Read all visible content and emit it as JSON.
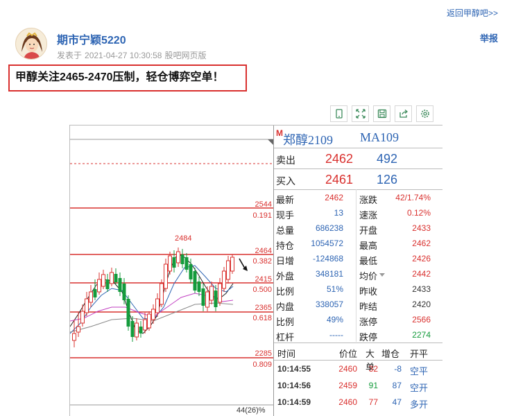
{
  "header": {
    "back_link": "返回甲醇吧>>",
    "author": "期市宁颖5220",
    "posted_label": "发表于",
    "posted_time": "2021-04-27 10:30:58",
    "source": "股吧网页版",
    "report": "举报"
  },
  "post": {
    "title": "甲醇关注2465-2470压制，轻仓博弈空单！"
  },
  "toolbar": {
    "icons": [
      "phone-icon",
      "expand-icon",
      "save-icon",
      "share-icon",
      "settings-icon"
    ]
  },
  "chart": {
    "levels": [
      {
        "price": "2544",
        "ratio": "0.191"
      },
      {
        "price": "2484",
        "ratio": ""
      },
      {
        "price": "2464",
        "ratio": "0.382"
      },
      {
        "price": "2415",
        "ratio": "0.500"
      },
      {
        "price": "2365",
        "ratio": "0.618"
      },
      {
        "price": "2285",
        "ratio": "0.809"
      }
    ],
    "bottom_label": "44(26)%"
  },
  "quote": {
    "marker": "M",
    "name": "郑醇2109",
    "ma": "MA109",
    "sell_label": "卖出",
    "sell_price": "2462",
    "sell_vol": "492",
    "buy_label": "买入",
    "buy_price": "2461",
    "buy_vol": "126",
    "rows": [
      {
        "a": "最新",
        "av": "2462",
        "ac": "red",
        "b": "涨跌",
        "bv": "42/1.74%",
        "bc": "red"
      },
      {
        "a": "现手",
        "av": "13",
        "ac": "blue",
        "b": "速涨",
        "bv": "0.12%",
        "bc": "red"
      },
      {
        "a": "总量",
        "av": "686238",
        "ac": "blue",
        "b": "开盘",
        "bv": "2433",
        "bc": "red"
      },
      {
        "a": "持仓",
        "av": "1054572",
        "ac": "blue",
        "b": "最高",
        "bv": "2462",
        "bc": "red"
      },
      {
        "a": "日增",
        "av": "-124868",
        "ac": "blue",
        "b": "最低",
        "bv": "2426",
        "bc": "red"
      },
      {
        "a": "外盘",
        "av": "348181",
        "ac": "blue",
        "b": "均价",
        "bv": "2442",
        "bc": "red"
      },
      {
        "a": "比例",
        "av": "51%",
        "ac": "blue",
        "b": "昨收",
        "bv": "2433",
        "bc": "black"
      },
      {
        "a": "内盘",
        "av": "338057",
        "ac": "blue",
        "b": "昨结",
        "bv": "2420",
        "bc": "black"
      },
      {
        "a": "比例",
        "av": "49%",
        "ac": "blue",
        "b": "涨停",
        "bv": "2566",
        "bc": "red"
      },
      {
        "a": "杠杆",
        "av": "-----",
        "ac": "blue",
        "b": "跌停",
        "bv": "2274",
        "bc": "green"
      }
    ],
    "trade_head": {
      "time": "时间",
      "price": "价位",
      "big": "大单",
      "inc": "增仓",
      "oc": "开平"
    },
    "trades": [
      {
        "time": "10:14:55",
        "price": "2460",
        "big": "32",
        "inc": "-8",
        "oc": "空平"
      },
      {
        "time": "10:14:56",
        "price": "2459",
        "big": "91",
        "inc": "87",
        "oc": "空开"
      },
      {
        "time": "10:14:59",
        "price": "2460",
        "big": "77",
        "inc": "47",
        "oc": "多开"
      }
    ]
  }
}
